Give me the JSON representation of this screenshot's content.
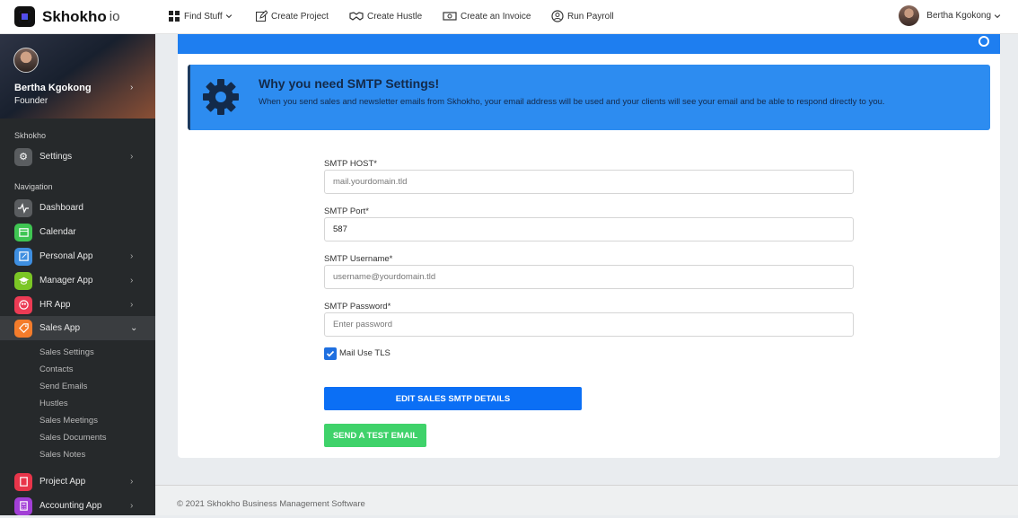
{
  "app": {
    "name": "Skhokho",
    "suffix": "io"
  },
  "topnav": [
    {
      "label": "Find Stuff",
      "icon": "grid-icon"
    },
    {
      "label": "Create Project",
      "icon": "edit-icon"
    },
    {
      "label": "Create Hustle",
      "icon": "handshake-icon"
    },
    {
      "label": "Create an Invoice",
      "icon": "money-icon"
    },
    {
      "label": "Run Payroll",
      "icon": "user-circle-icon"
    }
  ],
  "user": {
    "name": "Bertha Kgokong",
    "role": "Founder"
  },
  "sidebar": {
    "section_company": "Skhokho",
    "settings_label": "Settings",
    "section_nav": "Navigation",
    "items": [
      {
        "label": "Dashboard",
        "color": "#5a5d60"
      },
      {
        "label": "Calendar",
        "color": "#3fc552"
      },
      {
        "label": "Personal App",
        "color": "#3e8ee0"
      },
      {
        "label": "Manager App",
        "color": "#7bc625"
      },
      {
        "label": "HR App",
        "color": "#ec3b54"
      },
      {
        "label": "Sales App",
        "color": "#f47c2b"
      },
      {
        "label": "Project App",
        "color": "#e8354a"
      },
      {
        "label": "Accounting App",
        "color": "#a23fd6"
      }
    ],
    "sales_sub": [
      "Sales Settings",
      "Contacts",
      "Send Emails",
      "Hustles",
      "Sales Meetings",
      "Sales Documents",
      "Sales Notes"
    ]
  },
  "alert": {
    "title": "Why you need SMTP Settings!",
    "text": "When you send sales and newsletter emails from Skhokho, your email address will be used and your clients will see your email and be able to respond directly to you."
  },
  "form": {
    "host_label": "SMTP HOST*",
    "host_placeholder": "mail.yourdomain.tld",
    "port_label": "SMTP Port*",
    "port_value": "587",
    "username_label": "SMTP Username*",
    "username_placeholder": "username@yourdomain.tld",
    "password_label": "SMTP Password*",
    "password_placeholder": "Enter password",
    "tls_label": "Mail Use TLS",
    "tls_checked": true,
    "edit_button": "EDIT SALES SMTP DETAILS",
    "test_button": "SEND A TEST EMAIL"
  },
  "footer": "© 2021 Skhokho Business Management Software",
  "colors": {
    "accent": "#0b6ff5",
    "alert_bg": "#2d8cf0",
    "success": "#3fd26a",
    "sidebar_bg": "#26292b"
  }
}
